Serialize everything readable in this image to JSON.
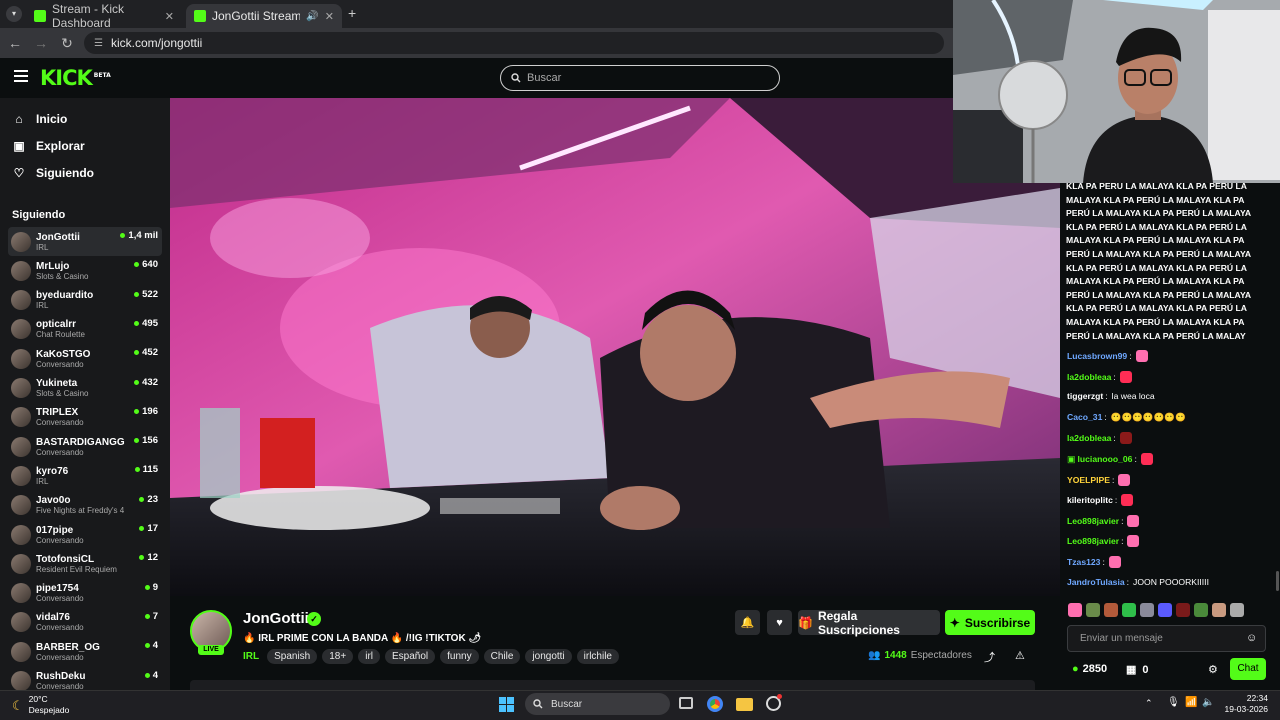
{
  "browser": {
    "tabs": [
      {
        "label": "Stream - Kick Dashboard",
        "active": false
      },
      {
        "label": "JonGottii Stream - Watch L",
        "active": true
      }
    ],
    "new_tab_icon": "plus-icon",
    "url": "kick.com/jongottii"
  },
  "header": {
    "logo": "KICK",
    "logo_badge": "BETA",
    "search_placeholder": "Buscar"
  },
  "sidebar": {
    "nav": [
      {
        "label": "Inicio",
        "icon": "home-icon"
      },
      {
        "label": "Explorar",
        "icon": "compass-icon"
      },
      {
        "label": "Siguiendo",
        "icon": "heart-icon"
      }
    ],
    "following_heading": "Siguiendo",
    "channels": [
      {
        "name": "JonGottii",
        "category": "IRL",
        "viewers": "1,4 mil"
      },
      {
        "name": "MrLujo",
        "category": "Slots & Casino",
        "viewers": "640"
      },
      {
        "name": "byeduardito",
        "category": "IRL",
        "viewers": "522"
      },
      {
        "name": "opticalrr",
        "category": "Chat Roulette",
        "viewers": "495"
      },
      {
        "name": "KaKoSTGO",
        "category": "Conversando",
        "viewers": "452"
      },
      {
        "name": "Yukineta",
        "category": "Slots & Casino",
        "viewers": "432"
      },
      {
        "name": "TRIPLEX",
        "category": "Conversando",
        "viewers": "196"
      },
      {
        "name": "BASTARDIGANGG",
        "category": "Conversando",
        "viewers": "156"
      },
      {
        "name": "kyro76",
        "category": "IRL",
        "viewers": "115"
      },
      {
        "name": "Javo0o",
        "category": "Five Nights at Freddy's 4",
        "viewers": "23"
      },
      {
        "name": "017pipe",
        "category": "Conversando",
        "viewers": "17"
      },
      {
        "name": "TotofonsiCL",
        "category": "Resident Evil Requiem",
        "viewers": "12"
      },
      {
        "name": "pipe1754",
        "category": "Conversando",
        "viewers": "9"
      },
      {
        "name": "vidal76",
        "category": "Conversando",
        "viewers": "7"
      },
      {
        "name": "BARBER_OG",
        "category": "Conversando",
        "viewers": "4"
      },
      {
        "name": "RushDeku",
        "category": "Conversando",
        "viewers": "4"
      }
    ]
  },
  "stream": {
    "streamer": "JonGottii",
    "live_badge": "LIVE",
    "title": "🔥 IRL PRIME CON LA BANDA 🔥 /!IG !TIKTOK 🌶",
    "category": "IRL",
    "tags": [
      "Spanish",
      "18+",
      "irl",
      "Español",
      "funny",
      "Chile",
      "jongotti",
      "irlchile"
    ],
    "gift_label": "Regala Suscripciones",
    "subscribe_label": "Suscribirse",
    "viewer_count": "1448",
    "viewer_label": "Espectadores"
  },
  "chat": {
    "spam_lines": [
      "KLA PA PERÚ LA MALAYA KLA PA PERÚ LA",
      "MALAYA KLA PA PERÚ LA MALAYA KLA PA",
      "PERÚ LA MALAYA KLA PA PERÚ LA MALAYA",
      "KLA PA PERÚ LA MALAYA KLA PA PERÚ LA",
      "MALAYA KLA PA PERÚ LA MALAYA KLA PA",
      "PERÚ LA MALAYA KLA PA PERÚ LA MALAYA",
      "KLA PA PERÚ LA MALAYA KLA PA PERÚ LA",
      "MALAYA KLA PA PERÚ LA MALAYA KLA PA",
      "PERÚ LA MALAYA KLA PA PERÚ LA MALAYA",
      "KLA PA PERÚ LA MALAYA KLA PA PERÚ LA",
      "MALAYA KLA PA PERÚ LA MALAYA KLA PA",
      "PERÚ LA MALAYA KLA PA PERÚ LA MALAY"
    ],
    "messages": [
      {
        "user": "Lucasbrown99",
        "color": "#6fa8ff",
        "text": "",
        "emote": "#ff6fb0"
      },
      {
        "user": "la2dobleaa",
        "color": "#53fc18",
        "text": "",
        "emote": "#ff2d55"
      },
      {
        "user": "tiggerzgt",
        "color": "#ffffff",
        "text": "la wea loca",
        "emote": ""
      },
      {
        "user": "Caco_31",
        "color": "#6fa8ff",
        "text": "😶😶😶😶😶😶😶",
        "emote": ""
      },
      {
        "user": "la2dobleaa",
        "color": "#53fc18",
        "text": "",
        "emote": "#8b1a1a"
      },
      {
        "user": "lucianooo_06",
        "color": "#53fc18",
        "text": "",
        "emote": "#ff2d55"
      },
      {
        "user": "YOELPIPE",
        "color": "#ffd43b",
        "text": "",
        "emote": "#ff6fb0"
      },
      {
        "user": "kileritoplitc",
        "color": "#ffffff",
        "text": "",
        "emote": "#ff2d55"
      },
      {
        "user": "Leo898javier",
        "color": "#53fc18",
        "text": "",
        "emote": "#ff6fb0"
      },
      {
        "user": "Leo898javier",
        "color": "#53fc18",
        "text": "",
        "emote": "#ff6fb0"
      },
      {
        "user": "Tzas123",
        "color": "#6fa8ff",
        "text": "",
        "emote": "#ff6fb0"
      },
      {
        "user": "JandroTulasia",
        "color": "#6fa8ff",
        "text": "JOON POOORKIIIII",
        "emote": ""
      }
    ],
    "input_placeholder": "Enviar un mensaje",
    "points": "2850",
    "coins": "0",
    "chat_button": "Chat"
  },
  "taskbar": {
    "temperature": "20°C",
    "weather": "Despejado",
    "search": "Buscar",
    "time": "22:34",
    "date": "19-03-2026"
  },
  "colors": {
    "accent": "#53fc18",
    "background": "#0b0e0f",
    "sidebar": "#18191b"
  }
}
